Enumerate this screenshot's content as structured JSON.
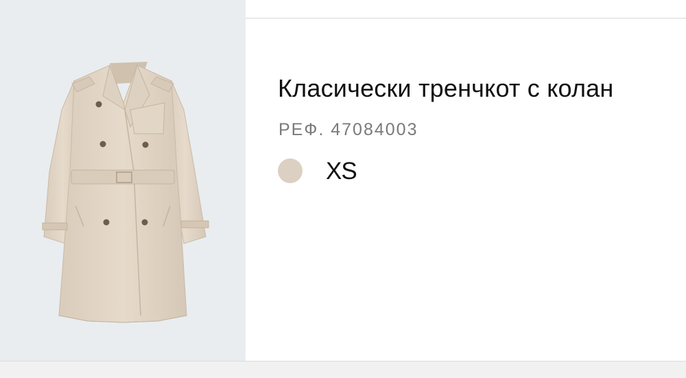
{
  "product": {
    "title": "Класически тренчкот с колан",
    "ref": "РЕФ. 47084003",
    "size": "XS",
    "swatch_color": "#dcd0c3"
  },
  "image": {
    "subject": "trench-coat-image",
    "background_color": "#e9edf0",
    "coat_color": "#e3d7c8"
  }
}
